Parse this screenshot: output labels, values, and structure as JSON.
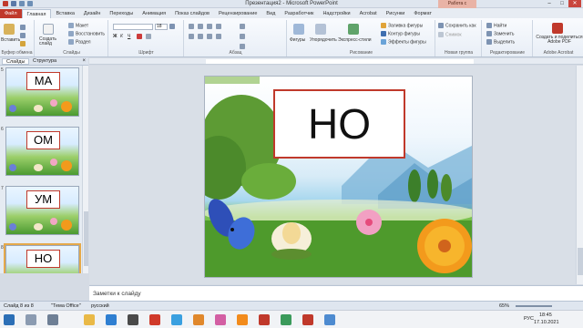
{
  "window": {
    "title": "Презентация2 - Microsoft PowerPoint",
    "context_tab": "Работа с рисунками",
    "controls": [
      "–",
      "□",
      "✕"
    ]
  },
  "tabs": [
    "Файл",
    "Главная",
    "Вставка",
    "Дизайн",
    "Переходы",
    "Анимация",
    "Показ слайдов",
    "Рецензирование",
    "Вид",
    "Разработчик",
    "Надстройки",
    "Acrobat",
    "Рисунки",
    "Формат"
  ],
  "active_tab": "Главная",
  "ribbon": {
    "clipboard": {
      "paste": "Вставить",
      "name": "Буфер обмена"
    },
    "slides": {
      "new_slide": "Создать слайд",
      "layout": "Макет",
      "reset": "Восстановить",
      "section": "Раздел",
      "name": "Слайды"
    },
    "font": {
      "size": "18",
      "name": "Шрифт"
    },
    "paragraph": {
      "name": "Абзац"
    },
    "drawing": {
      "shapes": "Фигуры",
      "arrange": "Упорядочить",
      "quick_styles": "Экспресс-стили",
      "fill": "Заливка фигуры",
      "outline": "Контур фигуры",
      "effects": "Эффекты фигуры",
      "name": "Рисование"
    },
    "new_group": {
      "save_as": "Сохранить как",
      "snapshot": "Снимок",
      "name": "Новая группа"
    },
    "editing": {
      "find": "Найти",
      "replace": "Заменить",
      "select": "Выделить",
      "name": "Редактирование"
    },
    "acrobat": {
      "create_pdf": "Создать и поделиться Adobe PDF",
      "name": "Adobe Acrobat"
    }
  },
  "left_pane": {
    "tabs": [
      "Слайды",
      "Структура"
    ],
    "close": "×",
    "thumbnails": [
      {
        "num": "5",
        "text": "МА"
      },
      {
        "num": "6",
        "text": "ОМ"
      },
      {
        "num": "7",
        "text": "УМ"
      },
      {
        "num": "8",
        "text": "НО"
      }
    ]
  },
  "slide": {
    "text": "НО"
  },
  "notes": {
    "placeholder": "Заметки к слайду"
  },
  "status": {
    "slide_info": "Слайд 8 из 8",
    "theme": "\"Тема Office\"",
    "language": "русский",
    "zoom": "65%"
  },
  "taskbar": {
    "lang": "РУС",
    "time": "18:45",
    "date": "17.10.2021"
  },
  "colors": {
    "file_tab": "#c0392b",
    "card_border": "#c0392b",
    "selection": "#e5a94a"
  }
}
